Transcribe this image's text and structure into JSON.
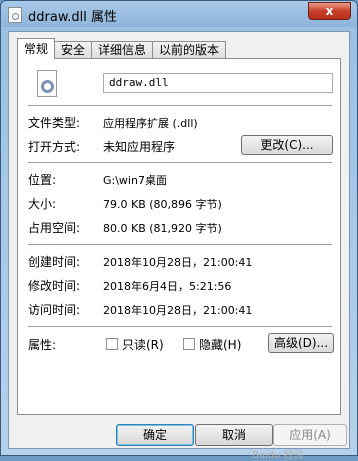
{
  "window": {
    "title": "ddraw.dll 属性",
    "close_glyph": "x"
  },
  "tabs": [
    {
      "label": "常规",
      "active": true
    },
    {
      "label": "安全",
      "active": false
    },
    {
      "label": "详细信息",
      "active": false
    },
    {
      "label": "以前的版本",
      "active": false
    }
  ],
  "general": {
    "file_name": "ddraw.dll",
    "file_type_label": "文件类型:",
    "file_type_value": "应用程序扩展 (.dll)",
    "opens_with_label": "打开方式:",
    "opens_with_value": "未知应用程序",
    "change_button": "更改(C)...",
    "location_label": "位置:",
    "location_value": "G:\\win7桌面",
    "size_label": "大小:",
    "size_value": "79.0 KB (80,896 字节)",
    "size_on_disk_label": "占用空间:",
    "size_on_disk_value": "80.0 KB (81,920 字节)",
    "created_label": "创建时间:",
    "created_value": "2018年10月28日，21:00:41",
    "modified_label": "修改时间:",
    "modified_value": "2018年6月4日，5:21:56",
    "accessed_label": "访问时间:",
    "accessed_value": "2018年10月28日，21:00:41",
    "attributes_label": "属性:",
    "readonly_label": "只读(R)",
    "readonly_checked": false,
    "hidden_label": "隐藏(H)",
    "hidden_checked": false,
    "advanced_button": "高级(D)..."
  },
  "footer": {
    "ok": "确定",
    "cancel": "取消",
    "apply": "应用(A)"
  },
  "watermark": "Baidu 经验"
}
